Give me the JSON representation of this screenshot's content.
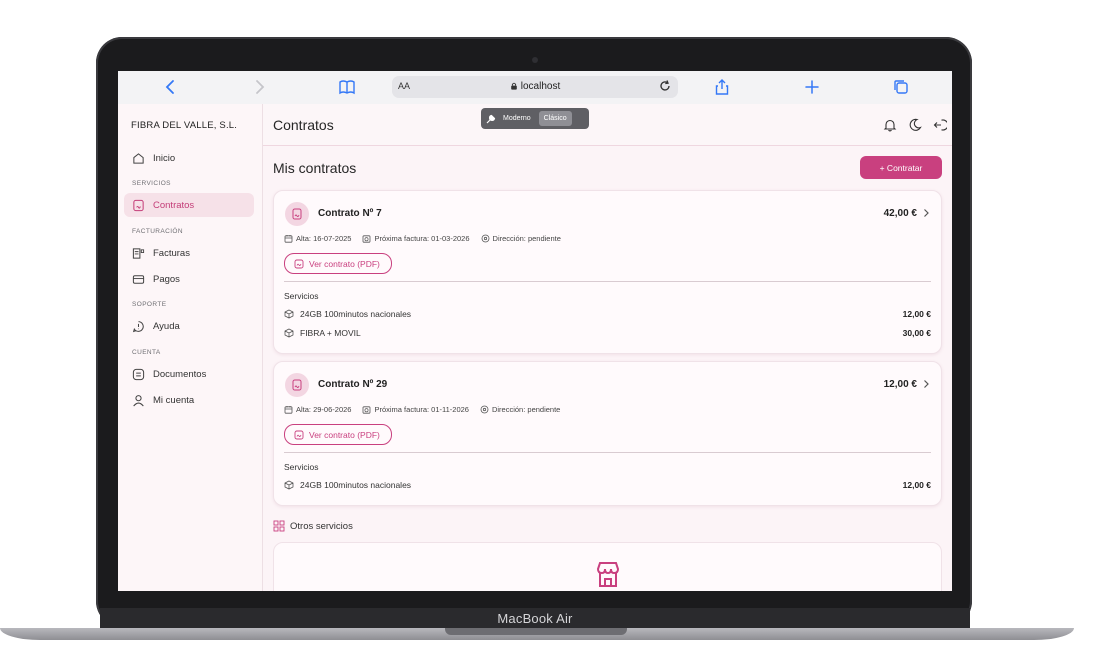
{
  "device": {
    "label": "MacBook Air"
  },
  "browser": {
    "aa_label": "AA",
    "url": "localhost"
  },
  "sidebar": {
    "brand": "FIBRA DEL VALLE, S.L.",
    "items": [
      {
        "label": "Inicio",
        "icon": "home-icon",
        "active": false
      },
      {
        "section": "SERVICIOS"
      },
      {
        "label": "Contratos",
        "icon": "contract-icon",
        "active": true
      },
      {
        "section": "FACTURACIÓN"
      },
      {
        "label": "Facturas",
        "icon": "invoice-icon",
        "active": false
      },
      {
        "label": "Pagos",
        "icon": "card-icon",
        "active": false
      },
      {
        "section": "SOPORTE"
      },
      {
        "label": "Ayuda",
        "icon": "help-icon",
        "active": false
      },
      {
        "section": "CUENTA"
      },
      {
        "label": "Documentos",
        "icon": "document-icon",
        "active": false
      },
      {
        "label": "Mi cuenta",
        "icon": "user-icon",
        "active": false
      }
    ]
  },
  "header": {
    "title": "Contratos",
    "toggle": {
      "option_a": "Moderno",
      "option_b": "Clásico",
      "selected": "Clásico"
    }
  },
  "main": {
    "section_title": "Mis contratos",
    "add_button": "+  Contratar",
    "contracts": [
      {
        "title": "Contrato Nº 7",
        "price": "42,00 €",
        "alta": "Alta: 16-07-2025",
        "proxima": "Próxima factura: 01-03-2026",
        "direccion": "Dirección: pendiente",
        "pdf_button": "Ver contrato (PDF)",
        "services_label": "Servicios",
        "services": [
          {
            "name": "24GB 100minutos nacionales",
            "price": "12,00 €"
          },
          {
            "name": "FIBRA + MOVIL",
            "price": "30,00 €"
          }
        ]
      },
      {
        "title": "Contrato Nº 29",
        "price": "12,00 €",
        "alta": "Alta: 29-06-2026",
        "proxima": "Próxima factura: 01-11-2026",
        "direccion": "Dirección: pendiente",
        "pdf_button": "Ver contrato (PDF)",
        "services_label": "Servicios",
        "services": [
          {
            "name": "24GB 100minutos nacionales",
            "price": "12,00 €"
          }
        ]
      }
    ],
    "others_title": "Otros servicios"
  },
  "colors": {
    "accent": "#c9407f",
    "active_bg": "#f6e1e8",
    "page_bg": "#fcf4f7"
  }
}
